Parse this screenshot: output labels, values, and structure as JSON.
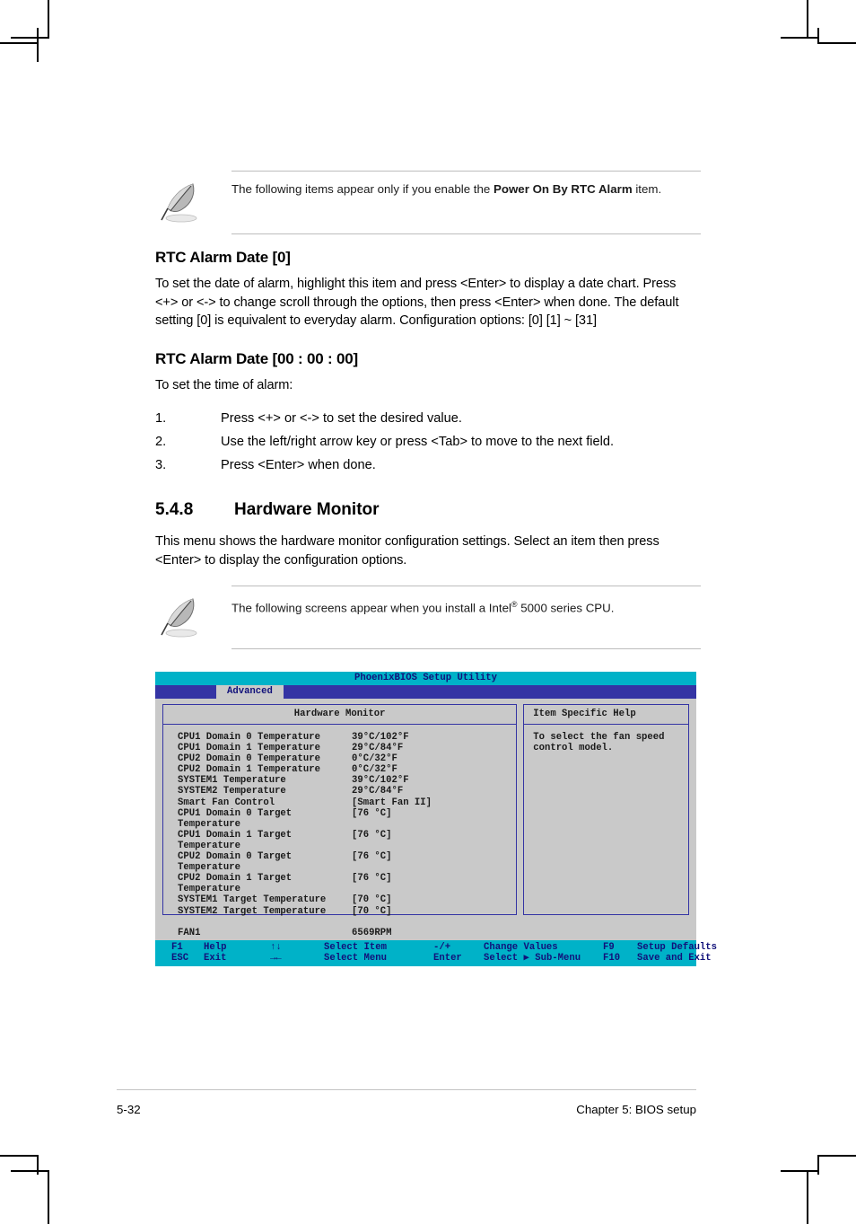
{
  "notes": [
    {
      "icon": "quill-pen-icon",
      "text_before": "The following items appear only if you enable the ",
      "text_bold": "Power On By RTC Alarm",
      "text_after": " item."
    },
    {
      "icon": "quill-pen-icon",
      "text_before": "The following screens appear when you install a Intel",
      "text_bold": "",
      "text_after": " 5000 series CPU."
    }
  ],
  "section_rtc_date": {
    "heading": "RTC Alarm Date [0]",
    "paragraph": "To set the date of alarm, highlight this item and press <Enter> to display a date chart. Press <+> or <-> to change scroll through the options, then press <Enter> when done. The default setting [0] is equivalent to everyday alarm. Configuration options: [0] [1] ~ [31]"
  },
  "section_rtc_time": {
    "heading": "RTC Alarm Date [00 : 00 : 00]",
    "paragraph": "To set the time of alarm:",
    "steps": [
      {
        "num": "1.",
        "text": "Press <+> or <-> to set the desired value."
      },
      {
        "num": "2.",
        "text": "Use the left/right arrow key or press <Tab> to move to the next field."
      },
      {
        "num": "3.",
        "text": "Press <Enter> when done."
      }
    ]
  },
  "section_hw_monitor": {
    "number": "5.4.8",
    "title": "Hardware Monitor",
    "paragraph": "This menu shows the hardware monitor configuration settings. Select an item then press <Enter> to display the configuration options."
  },
  "bios": {
    "title": "PhoenixBIOS Setup Utility",
    "active_tab": "Advanced",
    "left_panel_header": "Hardware Monitor",
    "right_panel_header": "Item Specific Help",
    "help_lines": [
      "To select the fan speed",
      "control model."
    ],
    "items": [
      {
        "label": "CPU1 Domain 0 Temperature",
        "value": "39°C/102°F"
      },
      {
        "label": "CPU1 Domain 1 Temperature",
        "value": "29°C/84°F"
      },
      {
        "label": "CPU2 Domain 0 Temperature",
        "value": "0°C/32°F"
      },
      {
        "label": "CPU2 Domain 1 Temperature",
        "value": "0°C/32°F"
      },
      {
        "label": "SYSTEM1 Temperature",
        "value": "39°C/102°F"
      },
      {
        "label": "SYSTEM2 Temperature",
        "value": "29°C/84°F"
      },
      {
        "label": "Smart Fan Control",
        "value": "[Smart Fan II]"
      },
      {
        "label": "CPU1 Domain 0 Target Temperature",
        "value": "[76 °C]"
      },
      {
        "label": "CPU1 Domain 1 Target Temperature",
        "value": "[76 °C]"
      },
      {
        "label": "CPU2 Domain 0 Target Temperature",
        "value": "[76 °C]"
      },
      {
        "label": "CPU2 Domain 1 Target Temperature",
        "value": "[76 °C]"
      },
      {
        "label": "SYSTEM1 Target Temperature",
        "value": "[70 °C]"
      },
      {
        "label": "SYSTEM2 Target Temperature",
        "value": "[70 °C]"
      },
      {
        "label": "",
        "value": ""
      },
      {
        "label": "FAN1",
        "value": "6569RPM"
      }
    ],
    "keys_row1": {
      "k1": "F1",
      "k2": "Help",
      "k3": "↑↓",
      "k4": "Select Item",
      "k5": "-/+",
      "k6": "Change Values",
      "k7": "F9",
      "k8": "Setup Defaults"
    },
    "keys_row2": {
      "k1": "ESC",
      "k2": "Exit",
      "k3": "→←",
      "k4": "Select Menu",
      "k5": "Enter",
      "k6": "Select ▶ Sub-Menu",
      "k7": "F10",
      "k8": "Save and Exit"
    },
    "colors": {
      "title_bar": "#00b2c8",
      "menu_bar": "#3434a4",
      "panel_bg": "#c9c9c9",
      "border": "#3434a4",
      "text": "#11117a"
    }
  },
  "footer": {
    "page_number": "5-32",
    "chapter": "Chapter 5: BIOS setup"
  }
}
